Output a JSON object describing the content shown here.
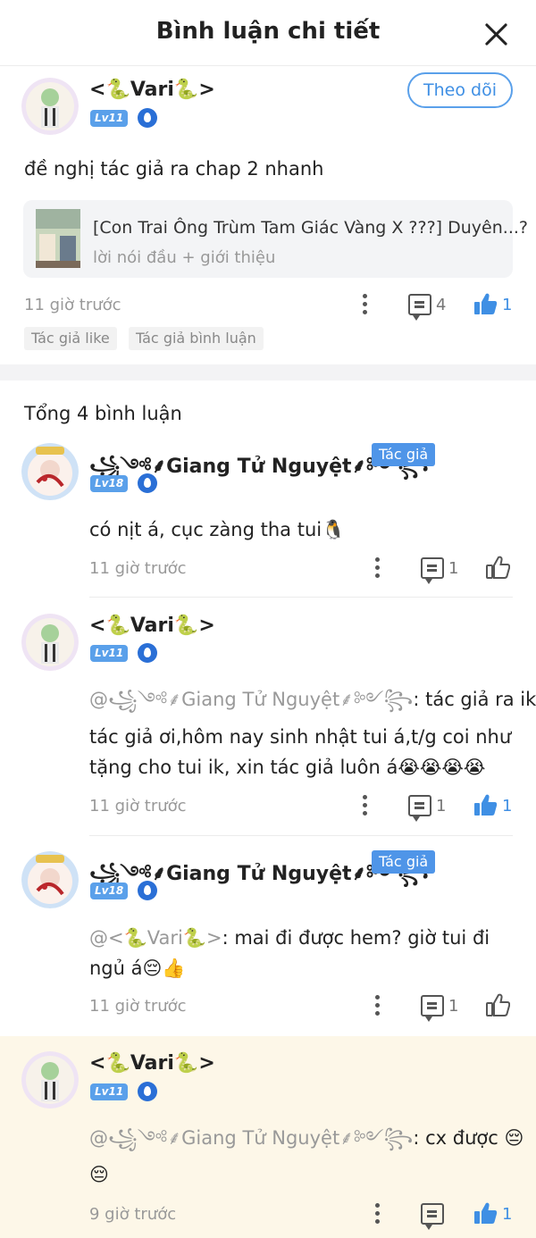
{
  "header": {
    "title": "Bình luận chi tiết"
  },
  "main_comment": {
    "user": {
      "prefix": "<",
      "name": "Vari",
      "suffix": ">",
      "level": "Lv11"
    },
    "follow_label": "Theo dõi",
    "text": "đề nghị tác giả ra chap 2 nhanh",
    "story": {
      "title": "[Con Trai Ông Trùm Tam Giác Vàng X ???] Duyên...?",
      "chapter": "lời nói đầu + giới thiệu"
    },
    "time": "11 giờ trước",
    "comment_count": "4",
    "like_count": "1",
    "tags": [
      "Tác giả like",
      "Tác giả bình luận"
    ]
  },
  "total_label": "Tổng 4 bình luận",
  "replies": [
    {
      "user": {
        "name": "Giang Tử Nguyệt",
        "level": "Lv18",
        "tag": "Tác giả"
      },
      "text": "có nịt á, cục zàng tha tui🐧",
      "time": "11 giờ trước",
      "comment_count": "1"
    },
    {
      "user": {
        "prefix": "<",
        "name": "Vari",
        "suffix": ">",
        "level": "Lv11"
      },
      "mention": "@꧁༺⸙Giang Tử Nguyệt⸙༻꧂",
      "text_line1": ": tác giả ra ik",
      "text_line2": "tác giả ơi,hôm nay sinh nhật tui á,t/g coi như",
      "text_line3": "tặng cho tui ik, xin tác giả luôn á😭😭😭😭",
      "time": "11 giờ trước",
      "comment_count": "1",
      "like_count": "1"
    },
    {
      "user": {
        "name": "Giang Tử Nguyệt",
        "level": "Lv18",
        "tag": "Tác giả"
      },
      "mention": "@<🐍Vari🐍>",
      "text_line1": ": mai đi được hem? giờ tui đi",
      "text_line2": "ngủ á😔👍",
      "time": "11 giờ trước",
      "comment_count": "1"
    },
    {
      "user": {
        "prefix": "<",
        "name": "Vari",
        "suffix": ">",
        "level": "Lv11"
      },
      "mention": "@꧁༺⸙Giang Tử Nguyệt⸙༻꧂",
      "text_line1": ": cx được 😔",
      "text_line2": "😔",
      "time": "9 giờ trước",
      "like_count": "1"
    }
  ],
  "colors": {
    "accent": "#3f8fe4",
    "author_tag": "#4f95e8",
    "highlight_bg": "#fdf7e8",
    "snake": "#3aa53a"
  }
}
